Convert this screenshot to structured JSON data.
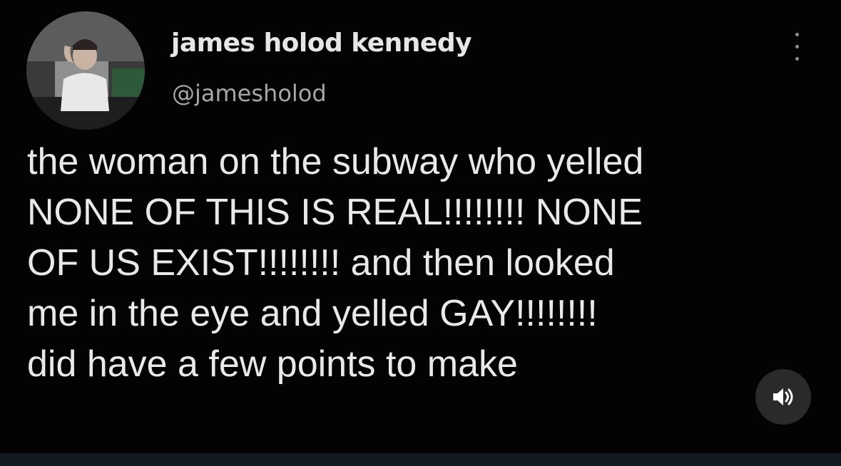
{
  "tweet": {
    "author": {
      "display_name": "james holod kennedy",
      "handle": "@jamesholod",
      "avatar_icon": "profile-photo"
    },
    "more_icon": "more-vertical-icon",
    "text_lines": [
      "the woman on the subway who yelled",
      "NONE OF THIS IS REAL!!!!!!!! NONE",
      "OF US EXIST!!!!!!!! and then looked",
      "me in the eye and yelled GAY!!!!!!!!",
      "did have a few points to make"
    ]
  },
  "media_controls": {
    "volume_icon": "speaker-volume-icon"
  },
  "colors": {
    "background": "#030303",
    "text": "#e9e9e9",
    "secondary_text": "#a6a6a6",
    "control_bg": "#2a2a2a",
    "bottom_bar": "#141a22"
  }
}
